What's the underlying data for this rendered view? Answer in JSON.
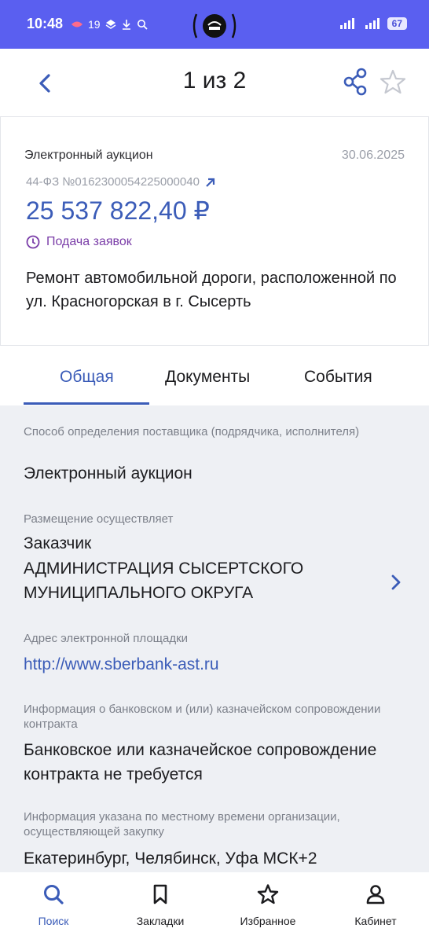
{
  "status_bar": {
    "time": "10:48",
    "notif_count": "19",
    "battery": "67"
  },
  "header": {
    "title": "1 из 2",
    "icons": [
      "back-arrow-icon",
      "share-icon",
      "star-outline-icon"
    ]
  },
  "card": {
    "type": "Электронный аукцион",
    "date": "30.06.2025",
    "number": "44-ФЗ №0162300054225000040",
    "price": "25 537 822,40 ₽",
    "stage": "Подача заявок",
    "description": "Ремонт автомобильной дороги, расположенной по ул. Красногорская в г. Сысерть"
  },
  "tabs": [
    {
      "label": "Общая",
      "active": true
    },
    {
      "label": "Документы",
      "active": false
    },
    {
      "label": "События",
      "active": false
    }
  ],
  "fields": {
    "method_label": "Способ определения поставщика (подрядчика, исполнителя)",
    "method_value": "Электронный аукцион",
    "placement_label": "Размещение осуществляет",
    "placement_role": "Заказчик",
    "placement_org": "АДМИНИСТРАЦИЯ СЫСЕРТСКОГО МУНИЦИПАЛЬНОГО ОКРУГА",
    "platform_label": "Адрес электронной площадки",
    "platform_url": "http://www.sberbank-ast.ru",
    "bank_label": "Информация о банковском и (или) казначейском сопровождении контракта",
    "bank_value": "Банковское или казначейское сопровождение контракта не требуется",
    "time_label": "Информация указана по местному времени организации, осуществляющей закупку",
    "time_value": "Екатеринбург, Челябинск, Уфа МСК+2"
  },
  "bottom_nav": [
    {
      "label": "Поиск",
      "icon": "search-icon",
      "active": true
    },
    {
      "label": "Закладки",
      "icon": "bookmark-icon",
      "active": false
    },
    {
      "label": "Избранное",
      "icon": "star-icon",
      "active": false
    },
    {
      "label": "Кабинет",
      "icon": "person-icon",
      "active": false
    }
  ],
  "colors": {
    "status_bar": "#5a5ff0",
    "accent": "#3b5cb8",
    "stage": "#7a3da8",
    "muted": "#7c808a",
    "background": "#eef0f4"
  }
}
